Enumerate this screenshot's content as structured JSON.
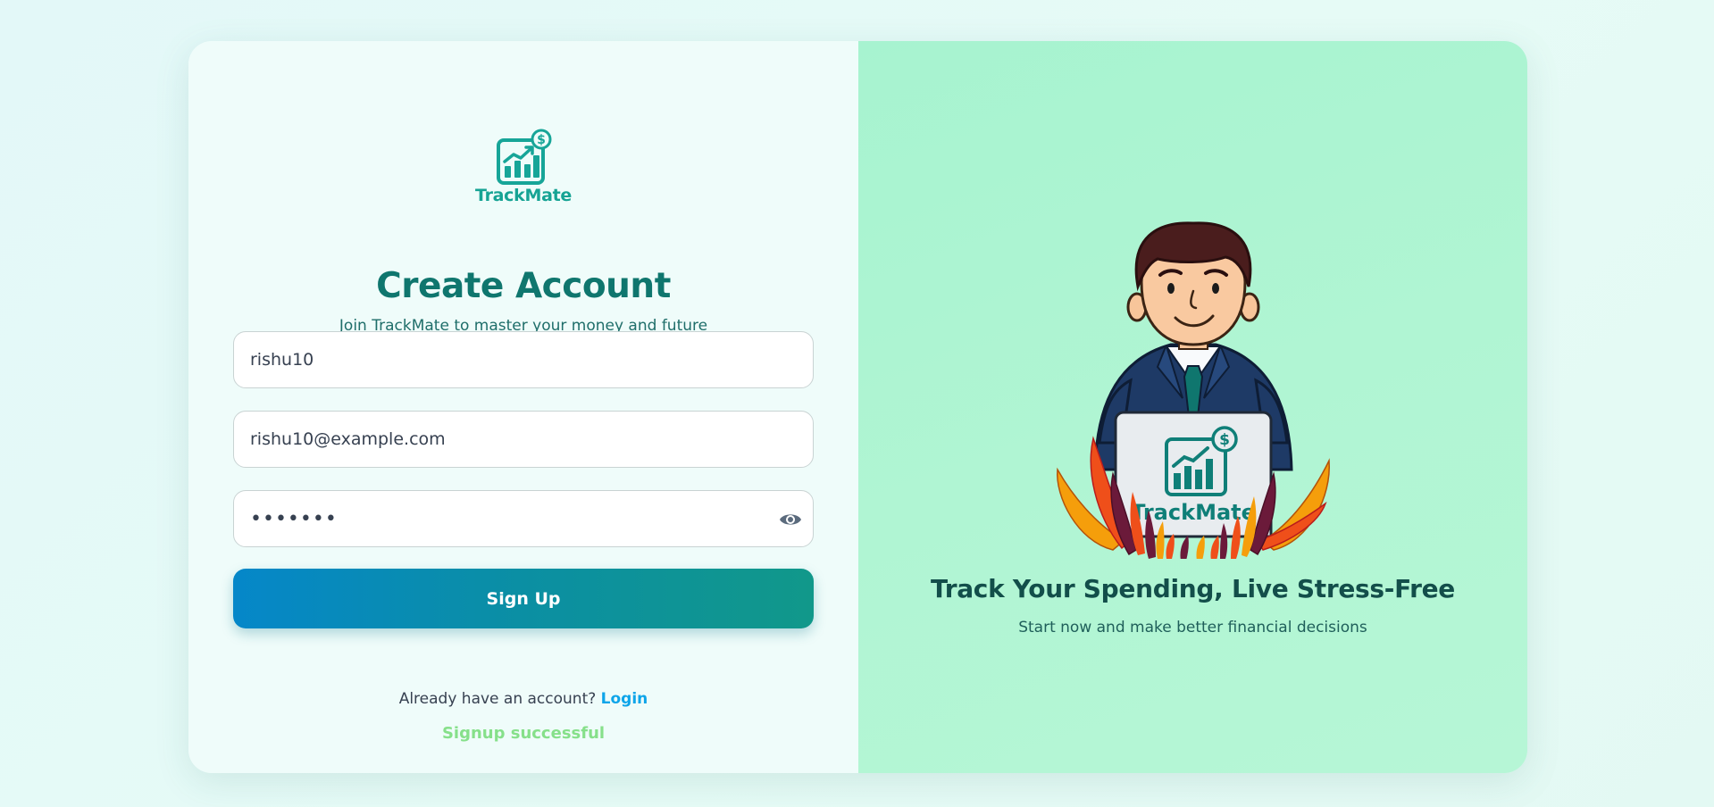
{
  "brand": {
    "name": "TrackMate",
    "logo_icon": "chart-growth-dollar-icon",
    "accent_color": "#0f766e"
  },
  "signup": {
    "title": "Create Account",
    "subtitle": "Join TrackMate to master your money and future",
    "username_value": "rishu10",
    "email_value": "rishu10@example.com",
    "password_value": "rishu10",
    "password_toggle_icon": "eye-icon",
    "submit_label": "Sign Up",
    "login_prompt": "Already have an account?",
    "login_link": "Login",
    "status_message": "Signup successful"
  },
  "hero": {
    "illustration": "businessman-with-laptop-illustration",
    "laptop_brand": "TrackMate",
    "heading": "Track Your Spending, Live Stress-Free",
    "subheading": "Start now and make better financial decisions"
  }
}
